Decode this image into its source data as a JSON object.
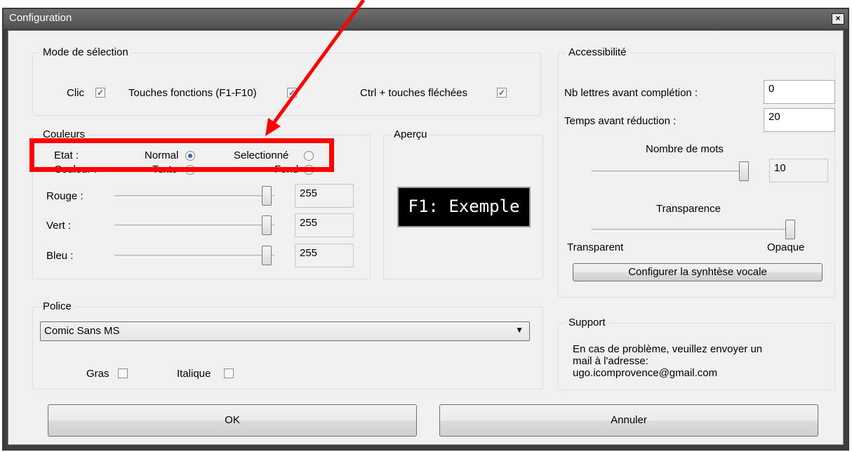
{
  "window": {
    "title": "Configuration",
    "close_label": "×"
  },
  "selection_mode": {
    "group_label": "Mode de sélection",
    "clic_label": "Clic",
    "function_keys_label": "Touches fonctions (F1-F10)",
    "ctrl_arrows_label": "Ctrl + touches fléchées",
    "checked_mark": "✓"
  },
  "colors": {
    "group_label": "Couleurs",
    "state_label": "Etat :",
    "normal_label": "Normal",
    "selected_label": "Selectionné",
    "color_label": "Couleur :",
    "text_label": "Texte",
    "background_label": "Fond",
    "red_label": "Rouge :",
    "green_label": "Vert :",
    "blue_label": "Bleu :",
    "red_value": "255",
    "green_value": "255",
    "blue_value": "255"
  },
  "preview": {
    "group_label": "Aperçu",
    "sample_text": "F1: Exemple"
  },
  "accessibility": {
    "group_label": "Accessibilité",
    "letters_before_completion_label": "Nb lettres avant complétion :",
    "letters_before_completion_value": "0",
    "time_before_reduction_label": "Temps avant réduction :",
    "time_before_reduction_value": "20",
    "word_count_label": "Nombre de mots",
    "word_count_value": "10",
    "transparency_label": "Transparence",
    "transparent_label": "Transparent",
    "opaque_label": "Opaque",
    "configure_speech_label": "Configurer la synhtèse vocale"
  },
  "font": {
    "group_label": "Police",
    "selected_font": "Comic Sans MS",
    "bold_label": "Gras",
    "italic_label": "Italique"
  },
  "support": {
    "group_label": "Support",
    "line1": "En cas de problème, veuillez envoyer un",
    "line2": "mail à l'adresse:",
    "email": "ugo.icomprovence@gmail.com"
  },
  "buttons": {
    "ok_label": "OK",
    "cancel_label": "Annuler"
  },
  "colors_theme": {
    "annotation": "#ff0000",
    "radio_accent": "#2f62c5",
    "check_accent": "#4a5f97"
  }
}
